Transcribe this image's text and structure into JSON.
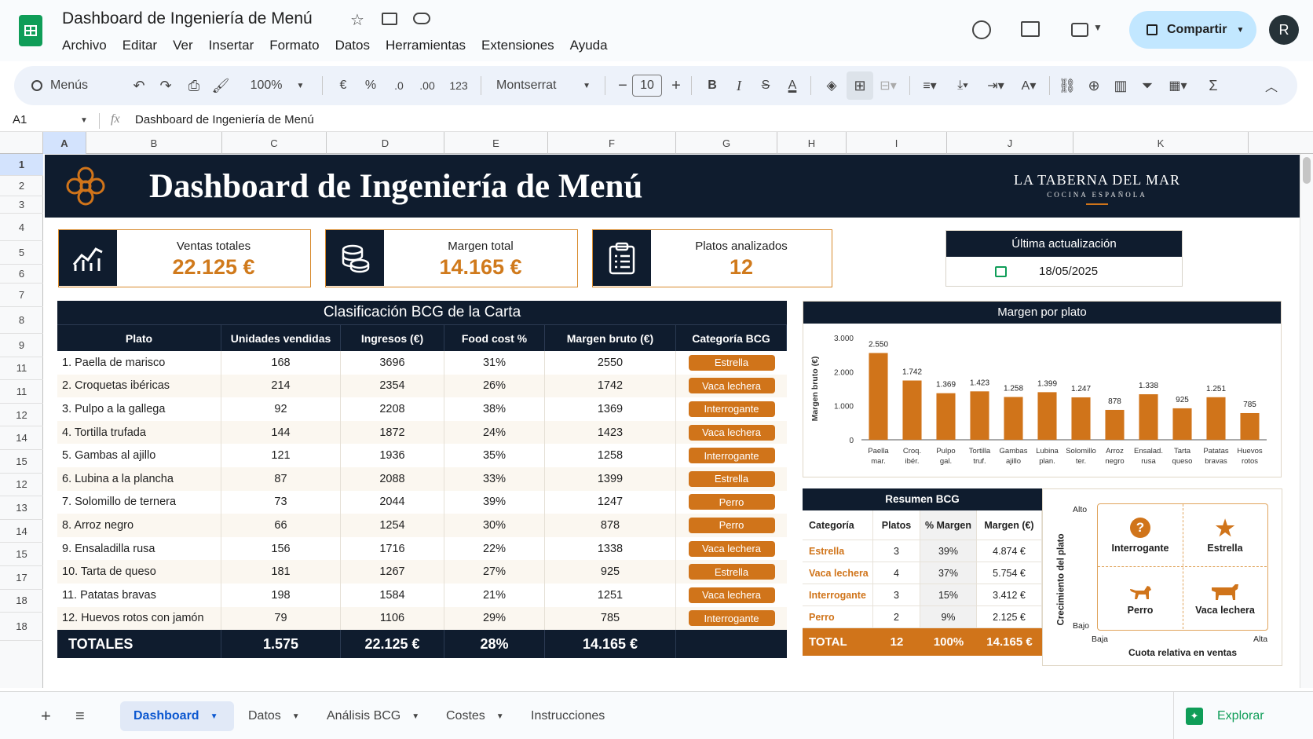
{
  "app": {
    "doc_title": "Dashboard de Ingeniería de Menú",
    "menu": [
      "Archivo",
      "Editar",
      "Ver",
      "Insertar",
      "Formato",
      "Datos",
      "Herramientas",
      "Extensiones",
      "Ayuda"
    ],
    "share_label": "Compartir",
    "avatar_letter": "R"
  },
  "toolbar": {
    "search_label": "Menús",
    "zoom": "100%",
    "currency": "€",
    "percent": "%",
    "dec_less": ".0",
    "dec_more": ".00",
    "format_123": "123",
    "font": "Montserrat",
    "font_size": "10"
  },
  "formula": {
    "cell_ref": "A1",
    "fx": "fx",
    "content": "Dashboard de Ingeniería de Menú"
  },
  "columns": [
    "A",
    "B",
    "C",
    "D",
    "E",
    "F",
    "G",
    "H",
    "I",
    "J",
    "K"
  ],
  "rows": [
    "1",
    "2",
    "3",
    "4",
    "5",
    "6",
    "7",
    "8",
    "9",
    "11",
    "11",
    "12",
    "14",
    "15",
    "12",
    "13",
    "14",
    "15",
    "17",
    "18",
    "18"
  ],
  "banner": {
    "title": "Dashboard de Ingeniería de Menú",
    "brand": "LA TABERNA DEL MAR",
    "brand_sub": "COCINA ESPAÑOLA"
  },
  "kpis": [
    {
      "label": "Ventas totales",
      "value": "22.125 €"
    },
    {
      "label": "Margen total",
      "value": "14.165 €"
    },
    {
      "label": "Platos analizados",
      "value": "12"
    }
  ],
  "update": {
    "label": "Última actualización",
    "date": "18/05/2025"
  },
  "table": {
    "title": "Clasificación BCG de la Carta",
    "headers": [
      "Plato",
      "Unidades vendidas",
      "Ingresos (€)",
      "Food cost %",
      "Margen bruto (€)",
      "Categoría BCG"
    ],
    "rows": [
      [
        "1. Paella de marisco",
        "168",
        "3696",
        "31%",
        "2550",
        "Estrella"
      ],
      [
        "2. Croquetas ibéricas",
        "214",
        "2354",
        "26%",
        "1742",
        "Vaca lechera"
      ],
      [
        "3. Pulpo a la gallega",
        "92",
        "2208",
        "38%",
        "1369",
        "Interrogante"
      ],
      [
        "4. Tortilla trufada",
        "144",
        "1872",
        "24%",
        "1423",
        "Vaca lechera"
      ],
      [
        "5. Gambas al ajillo",
        "121",
        "1936",
        "35%",
        "1258",
        "Interrogante"
      ],
      [
        "6. Lubina a la plancha",
        "87",
        "2088",
        "33%",
        "1399",
        "Estrella"
      ],
      [
        "7. Solomillo de ternera",
        "73",
        "2044",
        "39%",
        "1247",
        "Perro"
      ],
      [
        "8. Arroz negro",
        "66",
        "1254",
        "30%",
        "878",
        "Perro"
      ],
      [
        "9. Ensaladilla rusa",
        "156",
        "1716",
        "22%",
        "1338",
        "Vaca lechera"
      ],
      [
        "10. Tarta de queso",
        "181",
        "1267",
        "27%",
        "925",
        "Estrella"
      ],
      [
        "11. Patatas bravas",
        "198",
        "1584",
        "21%",
        "1251",
        "Vaca lechera"
      ],
      [
        "12. Huevos rotos con jamón",
        "79",
        "1106",
        "29%",
        "785",
        "Interrogante"
      ]
    ],
    "totals": [
      "TOTALES",
      "1.575",
      "22.125 €",
      "28%",
      "14.165 €",
      ""
    ]
  },
  "chart_data": {
    "type": "bar",
    "title": "Margen por plato",
    "ylabel": "Margen bruto (€)",
    "xlabel": "",
    "ylim": [
      0,
      3000
    ],
    "yticks": [
      "0",
      "1.000",
      "2.000",
      "3.000"
    ],
    "categories": [
      [
        "Paella",
        "mar."
      ],
      [
        "Croq.",
        "ibér."
      ],
      [
        "Pulpo",
        "gal."
      ],
      [
        "Tortilla",
        "truf."
      ],
      [
        "Gambas",
        "ajillo"
      ],
      [
        "Lubina",
        "plan."
      ],
      [
        "Solomillo",
        "ter."
      ],
      [
        "Arroz",
        "negro"
      ],
      [
        "Ensalad.",
        "rusa"
      ],
      [
        "Tarta",
        "queso"
      ],
      [
        "Patatas",
        "bravas"
      ],
      [
        "Huevos",
        "rotos"
      ]
    ],
    "values": [
      2550,
      1742,
      1369,
      1423,
      1258,
      1399,
      1247,
      878,
      1338,
      925,
      1251,
      785
    ],
    "labels": [
      "2.550",
      "1.742",
      "1.369",
      "1.423",
      "1.258",
      "1.399",
      "1.247",
      "878",
      "1.338",
      "925",
      "1.251",
      "785"
    ],
    "color": "#d0741a",
    "grid": false,
    "legend": "none"
  },
  "summary": {
    "title": "Resumen BCG",
    "headers": [
      "Categoría",
      "Platos",
      "% Margen",
      "Margen (€)"
    ],
    "rows": [
      [
        "Estrella",
        "3",
        "39%",
        "4.874 €"
      ],
      [
        "Vaca lechera",
        "4",
        "37%",
        "5.754 €"
      ],
      [
        "Interrogante",
        "3",
        "15%",
        "3.412 €"
      ],
      [
        "Perro",
        "2",
        "9%",
        "2.125 €"
      ]
    ],
    "total": [
      "TOTAL",
      "12",
      "100%",
      "14.165 €"
    ]
  },
  "matrix": {
    "y_label": "Crecimiento del plato",
    "y_high": "Alto",
    "y_low": "Bajo",
    "x_label": "Cuota relativa en ventas",
    "x_low": "Baja",
    "x_high": "Alta",
    "cells": [
      "Interrogante",
      "Estrella",
      "Perro",
      "Vaca lechera"
    ]
  },
  "sheets": {
    "tabs": [
      "Dashboard",
      "Datos",
      "Análisis BCG",
      "Costes",
      "Instrucciones"
    ],
    "explore": "Explorar"
  },
  "colors": {
    "navy": "#0f1c2e",
    "orange": "#d0741a"
  }
}
